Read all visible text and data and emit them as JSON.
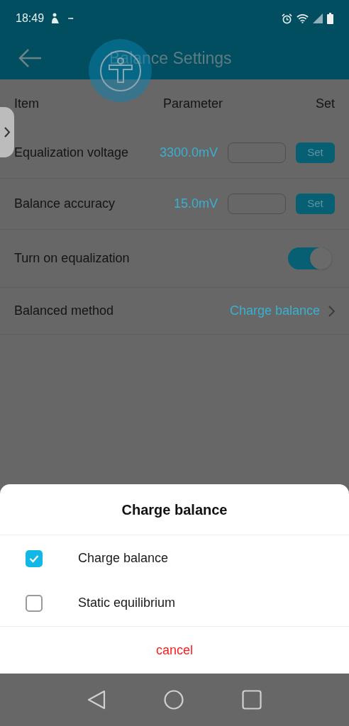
{
  "status_bar": {
    "time": "18:49",
    "notification_glyph": "•••"
  },
  "header": {
    "title": "Balance Settings"
  },
  "table": {
    "columns": [
      "Item",
      "Parameter",
      "Set"
    ],
    "rows": [
      {
        "kind": "input",
        "label": "Equalization voltage",
        "value": "3300.0mV",
        "button": "Set"
      },
      {
        "kind": "input",
        "label": "Balance accuracy",
        "value": "15.0mV",
        "button": "Set"
      },
      {
        "kind": "toggle",
        "label": "Turn on equalization",
        "on": true
      },
      {
        "kind": "link",
        "label": "Balanced method",
        "method": "Charge balance"
      }
    ]
  },
  "sheet": {
    "title": "Charge balance",
    "options": [
      {
        "label": "Charge balance",
        "checked": true
      },
      {
        "label": "Static equilibrium",
        "checked": false
      }
    ],
    "cancel": "cancel"
  }
}
